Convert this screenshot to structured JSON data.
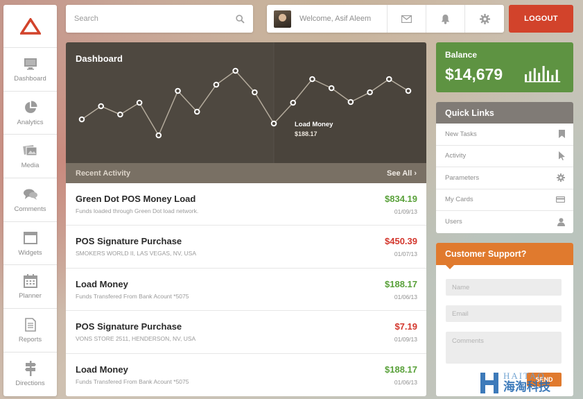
{
  "sidebar": {
    "items": [
      {
        "label": "Dashboard",
        "icon": "monitor-icon"
      },
      {
        "label": "Analytics",
        "icon": "pie-chart-icon"
      },
      {
        "label": "Media",
        "icon": "photos-icon"
      },
      {
        "label": "Comments",
        "icon": "chat-bubbles-icon"
      },
      {
        "label": "Widgets",
        "icon": "window-icon"
      },
      {
        "label": "Planner",
        "icon": "calendar-icon"
      },
      {
        "label": "Reports",
        "icon": "document-icon"
      },
      {
        "label": "Directions",
        "icon": "signpost-icon"
      }
    ]
  },
  "header": {
    "search_placeholder": "Search",
    "welcome": "Welcome, Asif Aleem",
    "logout_label": "LOGOUT"
  },
  "dashboard": {
    "title": "Dashboard",
    "tooltip_label": "Load Money",
    "tooltip_value": "$188.17"
  },
  "chart_data": {
    "type": "line",
    "title": "Dashboard",
    "series": [
      {
        "values": [
          172,
          153,
          165,
          148,
          195,
          131,
          161,
          122,
          102,
          133,
          178,
          148,
          114,
          127,
          147,
          133,
          114,
          131
        ]
      }
    ],
    "highlight_index": 10,
    "axes_visible": false,
    "grid": false,
    "line_color": "#b4ab9c",
    "point_fill": "#ffffff",
    "point_stroke": "#4e4840"
  },
  "recent_activity": {
    "title": "Recent Activity",
    "see_all": "See All",
    "rows": [
      {
        "name": "Green Dot POS Money Load",
        "sub": "Funds loaded through Green Dot load network.",
        "amount": "$834.19",
        "date": "01/09/13",
        "type": "credit"
      },
      {
        "name": "POS Signature Purchase",
        "sub": "SMOKERS WORLD II, LAS VEGAS, NV, USA",
        "amount": "$450.39",
        "date": "01/07/13",
        "type": "debit"
      },
      {
        "name": "Load Money",
        "sub": "Funds Transfered From Bank Acount *5075",
        "amount": "$188.17",
        "date": "01/06/13",
        "type": "credit"
      },
      {
        "name": "POS Signature Purchase",
        "sub": "VONS STORE 2511, HENDERSON, NV, USA",
        "amount": "$7.19",
        "date": "01/09/13",
        "type": "debit"
      },
      {
        "name": "Load Money",
        "sub": "Funds Transfered From Bank Acount *5075",
        "amount": "$188.17",
        "date": "01/06/13",
        "type": "credit"
      }
    ]
  },
  "colors": {
    "credit": "#59a13a",
    "debit": "#d3372d",
    "balance_bg": "#5e9342",
    "logout_bg": "#d2432b",
    "support_bg": "#e07a2e"
  },
  "balance": {
    "label": "Balance",
    "value": "$14,679",
    "bars": [
      0.45,
      0.65,
      0.85,
      0.55,
      1.0,
      0.7,
      0.4,
      0.75
    ]
  },
  "quick_links": {
    "title": "Quick Links",
    "items": [
      {
        "label": "New Tasks",
        "icon": "bookmark-icon"
      },
      {
        "label": "Activity",
        "icon": "cursor-icon"
      },
      {
        "label": "Parameters",
        "icon": "gear-icon"
      },
      {
        "label": "My Cards",
        "icon": "credit-card-icon"
      },
      {
        "label": "Users",
        "icon": "user-icon"
      }
    ]
  },
  "support": {
    "title": "Customer Support?",
    "name_placeholder": "Name",
    "email_placeholder": "Email",
    "comments_placeholder": "Comments",
    "send_label": "SEND"
  },
  "watermark": {
    "text_en": "HAITAO",
    "text_cn": "海淘科技"
  }
}
